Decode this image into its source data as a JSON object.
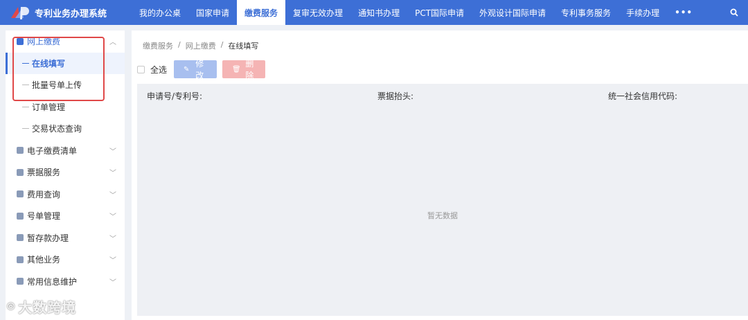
{
  "app": {
    "title": "专利业务办理系统"
  },
  "nav": {
    "items": [
      "我的办公桌",
      "国家申请",
      "缴费服务",
      "复审无效办理",
      "通知书办理",
      "PCT国际申请",
      "外观设计国际申请",
      "专利事务服务",
      "手续办理"
    ],
    "active_index": 2,
    "more": "•••"
  },
  "sidebar": {
    "groups": [
      {
        "label": "网上缴费",
        "icon": "wallet-icon",
        "open": true,
        "children": [
          "在线填写",
          "批量号单上传",
          "订单管理",
          "交易状态查询"
        ],
        "active_child": 0
      },
      {
        "label": "电子缴费清单",
        "icon": "list-icon"
      },
      {
        "label": "票据服务",
        "icon": "receipt-icon"
      },
      {
        "label": "费用查询",
        "icon": "fee-icon"
      },
      {
        "label": "号单管理",
        "icon": "doc-icon"
      },
      {
        "label": "暂存款办理",
        "icon": "deposit-icon"
      },
      {
        "label": "其他业务",
        "icon": "user-icon"
      },
      {
        "label": "常用信息维护",
        "icon": "info-icon"
      }
    ]
  },
  "breadcrumb": [
    "缴费服务",
    "网上缴费",
    "在线填写"
  ],
  "toolbar": {
    "select_all": "全选",
    "edit": "修改",
    "delete": "删除"
  },
  "table": {
    "columns": [
      "申请号/专利号:",
      "票据抬头:",
      "统一社会信用代码:"
    ],
    "empty_text": "暂无数据"
  },
  "watermark": "大数跨境",
  "colors": {
    "primary": "#3d6fd6",
    "highlight": "#e04848"
  }
}
